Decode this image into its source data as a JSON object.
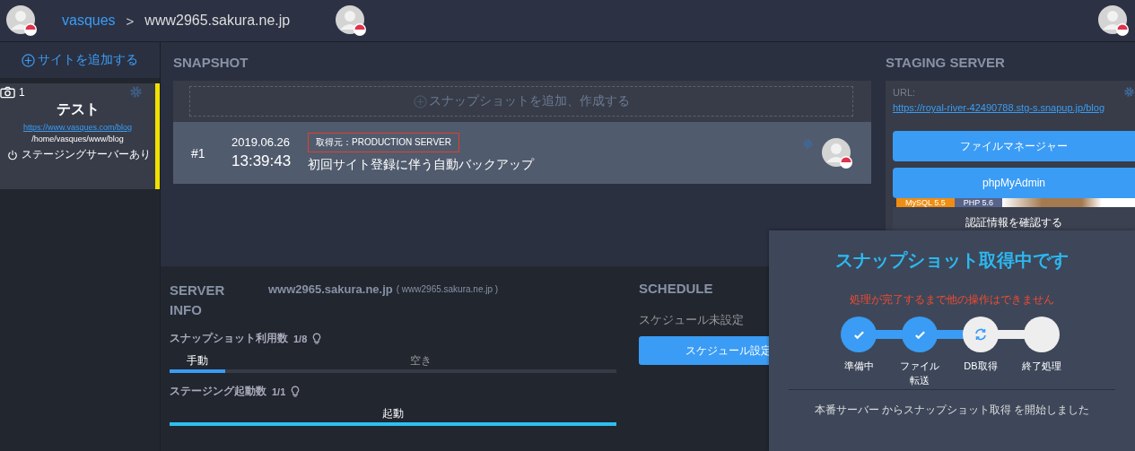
{
  "header": {
    "account": "vasques",
    "separator": ">",
    "server": "www2965.sakura.ne.jp"
  },
  "sidebar": {
    "add_site": "サイトを追加する",
    "site": {
      "snapshot_count": "1",
      "name": "テスト",
      "url": "https://www.vasques.com/blog",
      "path": "/home/vasques/www/blog",
      "staging": "ステージングサーバーあり",
      "selected": true
    }
  },
  "snapshot": {
    "title": "SNAPSHOT",
    "add": "スナップショットを追加、作成する",
    "items": [
      {
        "number": "#1",
        "date": "2019.06.26",
        "time": "13:39:43",
        "source": "取得元：PRODUCTION SERVER",
        "description": "初回サイト登録に伴う自動バックアップ"
      }
    ]
  },
  "staging": {
    "title": "STAGING SERVER",
    "url_label": "URL:",
    "url": "https://royal-river-42490788.stg-s.snapup.jp/blog",
    "buttons": [
      "ファイルマネージャー",
      "phpMyAdmin"
    ],
    "badges": [
      "MySQL 5.5",
      "PHP 5.6"
    ],
    "partial_button": "認証情報を確認する"
  },
  "server_info": {
    "title_1": "SERVER",
    "title_2": "INFO",
    "host": "www2965.sakura.ne.jp",
    "host_detail": "( www2965.sakura.ne.jp )",
    "usage": [
      {
        "label": "スナップショット利用数",
        "count": "1/8",
        "used_label": "手動",
        "free_label": "空き",
        "level": 0.125
      },
      {
        "label": "ステージング起動数",
        "count": "1/1",
        "used_label": "起動",
        "level": 1
      }
    ]
  },
  "schedule": {
    "title": "SCHEDULE",
    "status": "スケジュール未設定",
    "button": "スケジュール設定"
  },
  "modal": {
    "title": "スナップショット取得中です",
    "warning": "処理が完了するまで他の操作はできません",
    "steps": [
      {
        "label": "準備中",
        "kind": "done"
      },
      {
        "label": "ファイル転送",
        "kind": "done"
      },
      {
        "label": "DB取得",
        "kind": "active"
      },
      {
        "label": "終了処理",
        "kind": "pending"
      }
    ],
    "message": "本番サーバー からスナップショット取得  を開始しました"
  }
}
